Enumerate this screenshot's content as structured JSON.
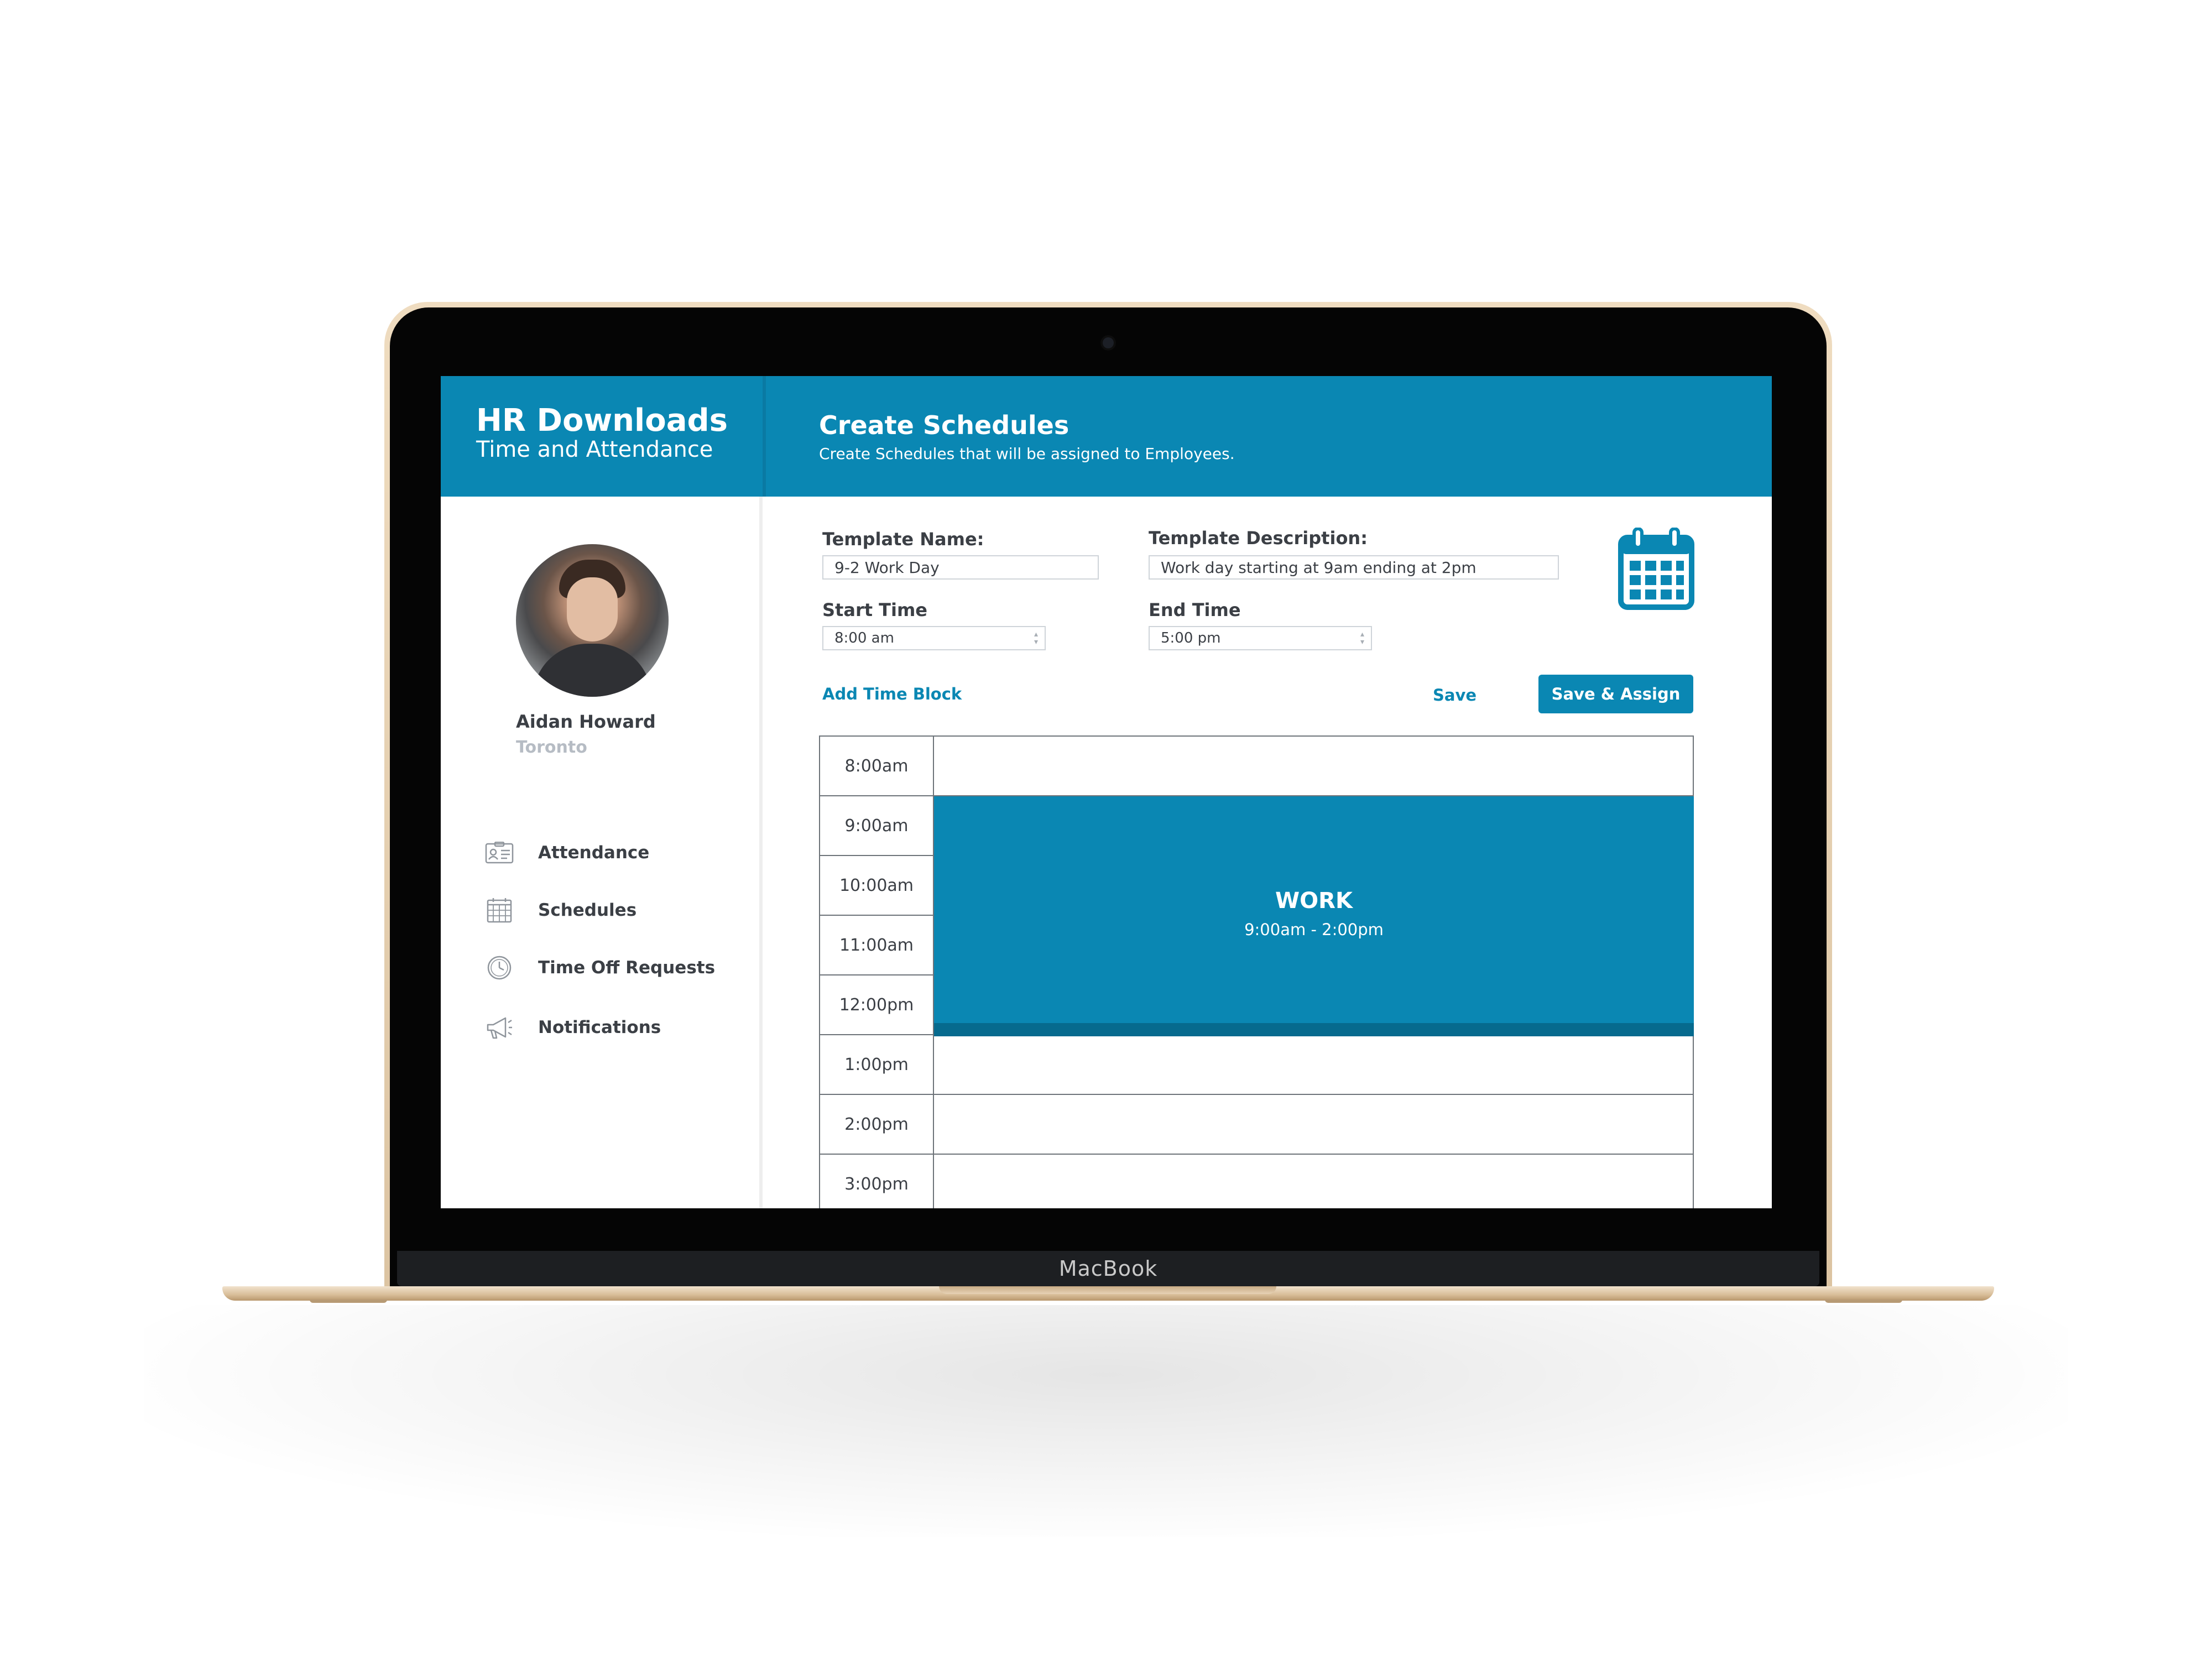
{
  "device": {
    "brand": "MacBook"
  },
  "app": {
    "title": "HR Downloads",
    "subtitle": "Time and Attendance"
  },
  "header": {
    "title": "Create Schedules",
    "subtitle": "Create Schedules that will be assigned to Employees."
  },
  "user": {
    "name": "Aidan Howard",
    "location": "Toronto"
  },
  "sidebar": {
    "items": [
      {
        "label": "Attendance",
        "icon": "id-card-icon"
      },
      {
        "label": "Schedules",
        "icon": "calendar-icon"
      },
      {
        "label": "Time Off Requests",
        "icon": "clock-icon"
      },
      {
        "label": "Notifications",
        "icon": "megaphone-icon"
      }
    ]
  },
  "form": {
    "template_name_label": "Template Name:",
    "template_name_value": "9-2 Work Day",
    "template_description_label": "Template Description:",
    "template_description_value": "Work day starting at 9am ending at 2pm",
    "start_time_label": "Start Time",
    "start_time_value": "8:00 am",
    "end_time_label": "End Time",
    "end_time_value": "5:00 pm",
    "add_time_block_label": "Add Time Block",
    "save_label": "Save",
    "save_assign_label": "Save & Assign"
  },
  "schedule": {
    "rows": [
      "8:00am",
      "9:00am",
      "10:00am",
      "11:00am",
      "12:00pm",
      "1:00pm",
      "2:00pm",
      "3:00pm"
    ],
    "block": {
      "title": "WORK",
      "range": "9:00am - 2:00pm"
    }
  },
  "colors": {
    "brand": "#0a87b3",
    "brand_dark": "#066a8e",
    "text": "#3b3f45",
    "muted": "#b6bcc4"
  }
}
